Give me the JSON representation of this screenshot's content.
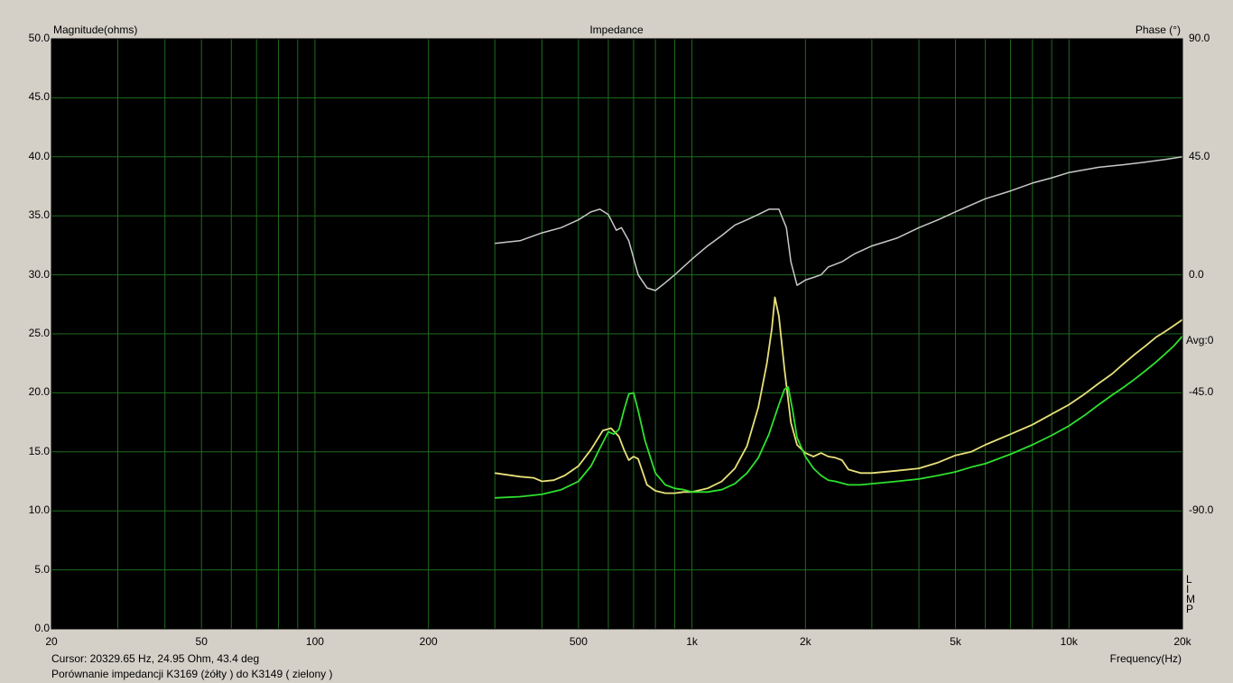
{
  "chart_data": {
    "type": "line",
    "title": "Impedance",
    "ylabel": "Magnitude(ohms)",
    "y2label": "Phase (°)",
    "xlabel": "Frequency(Hz)",
    "xscale": "log",
    "xlim": [
      20,
      20000
    ],
    "ylim": [
      0,
      50
    ],
    "y2lim": [
      -135,
      90
    ],
    "grid": true,
    "x_ticks": [
      {
        "v": 20,
        "label": "20"
      },
      {
        "v": 50,
        "label": "50"
      },
      {
        "v": 100,
        "label": "100"
      },
      {
        "v": 200,
        "label": "200"
      },
      {
        "v": 500,
        "label": "500"
      },
      {
        "v": 1000,
        "label": "1k"
      },
      {
        "v": 2000,
        "label": "2k"
      },
      {
        "v": 5000,
        "label": "5k"
      },
      {
        "v": 10000,
        "label": "10k"
      },
      {
        "v": 20000,
        "label": "20k"
      }
    ],
    "y_ticks": [
      {
        "v": 0,
        "label": "0.0"
      },
      {
        "v": 5,
        "label": "5.0"
      },
      {
        "v": 10,
        "label": "10.0"
      },
      {
        "v": 15,
        "label": "15.0"
      },
      {
        "v": 20,
        "label": "20.0"
      },
      {
        "v": 25,
        "label": "25.0"
      },
      {
        "v": 30,
        "label": "30.0"
      },
      {
        "v": 35,
        "label": "35.0"
      },
      {
        "v": 40,
        "label": "40.0"
      },
      {
        "v": 45,
        "label": "45.0"
      },
      {
        "v": 50,
        "label": "50.0"
      }
    ],
    "y2_ticks": [
      {
        "v": 90,
        "label": "90.0"
      },
      {
        "v": 45,
        "label": "45.0"
      },
      {
        "v": 0,
        "label": "0.0"
      },
      {
        "v": -45,
        "label": "-45.0"
      },
      {
        "v": -90,
        "label": "-90.0"
      }
    ],
    "avg_label": "Avg:0",
    "side_letters": [
      "L",
      "I",
      "M",
      "P"
    ],
    "series": [
      {
        "color": "#e8e07a",
        "axis": "left",
        "x": [
          300,
          350,
          380,
          400,
          430,
          460,
          500,
          540,
          580,
          610,
          640,
          660,
          680,
          700,
          720,
          760,
          800,
          850,
          900,
          950,
          1000,
          1100,
          1200,
          1300,
          1400,
          1500,
          1580,
          1630,
          1660,
          1700,
          1760,
          1830,
          1900,
          2000,
          2100,
          2200,
          2300,
          2400,
          2500,
          2600,
          2800,
          3000,
          3500,
          4000,
          4500,
          5000,
          5500,
          6000,
          7000,
          8000,
          9000,
          10000,
          11000,
          12000,
          13000,
          14000,
          15000,
          16000,
          17000,
          18000,
          19000,
          20000
        ],
        "y": [
          13.2,
          12.9,
          12.8,
          12.5,
          12.6,
          13.0,
          13.8,
          15.2,
          16.8,
          17.0,
          16.3,
          15.2,
          14.3,
          14.6,
          14.4,
          12.2,
          11.7,
          11.5,
          11.5,
          11.6,
          11.6,
          11.9,
          12.5,
          13.6,
          15.5,
          18.8,
          22.5,
          25.5,
          28.1,
          26.5,
          22.0,
          17.5,
          15.6,
          14.9,
          14.6,
          14.9,
          14.6,
          14.5,
          14.3,
          13.5,
          13.2,
          13.2,
          13.4,
          13.6,
          14.1,
          14.7,
          15.0,
          15.6,
          16.5,
          17.3,
          18.2,
          19.0,
          19.9,
          20.8,
          21.6,
          22.5,
          23.3,
          24.0,
          24.7,
          25.2,
          25.7,
          26.2
        ]
      },
      {
        "color": "#2ee02e",
        "axis": "left",
        "x": [
          300,
          350,
          400,
          450,
          500,
          540,
          570,
          600,
          620,
          640,
          660,
          680,
          700,
          720,
          750,
          800,
          850,
          900,
          950,
          1000,
          1100,
          1200,
          1300,
          1400,
          1500,
          1600,
          1700,
          1760,
          1800,
          1850,
          1900,
          2000,
          2100,
          2200,
          2300,
          2400,
          2600,
          2800,
          3000,
          3500,
          4000,
          4500,
          5000,
          5500,
          6000,
          7000,
          8000,
          9000,
          10000,
          11000,
          12000,
          13000,
          14000,
          15000,
          16000,
          17000,
          18000,
          19000,
          20000
        ],
        "y": [
          11.1,
          11.2,
          11.4,
          11.8,
          12.5,
          13.8,
          15.3,
          16.7,
          16.5,
          16.9,
          18.5,
          19.9,
          20.0,
          18.5,
          16.0,
          13.2,
          12.2,
          11.9,
          11.8,
          11.6,
          11.6,
          11.8,
          12.3,
          13.2,
          14.5,
          16.5,
          19.0,
          20.3,
          20.5,
          18.5,
          16.2,
          14.6,
          13.6,
          13.0,
          12.6,
          12.5,
          12.2,
          12.2,
          12.3,
          12.5,
          12.7,
          13.0,
          13.3,
          13.7,
          14.0,
          14.8,
          15.6,
          16.4,
          17.2,
          18.1,
          19.0,
          19.8,
          20.5,
          21.2,
          21.9,
          22.6,
          23.3,
          24.0,
          24.8
        ]
      },
      {
        "color": "#c8c8c8",
        "axis": "right",
        "x": [
          300,
          350,
          400,
          450,
          500,
          540,
          570,
          600,
          630,
          650,
          680,
          720,
          760,
          800,
          850,
          900,
          1000,
          1100,
          1200,
          1300,
          1400,
          1500,
          1600,
          1700,
          1780,
          1830,
          1900,
          1950,
          2000,
          2100,
          2200,
          2300,
          2500,
          2700,
          3000,
          3500,
          4000,
          4500,
          5000,
          6000,
          7000,
          8000,
          9000,
          10000,
          12000,
          14000,
          16000,
          18000,
          20000
        ],
        "y": [
          12,
          13,
          16,
          18,
          21,
          24,
          25,
          23,
          17,
          18,
          13,
          0,
          -5,
          -6,
          -3,
          0,
          6,
          11,
          15,
          19,
          21,
          23,
          25,
          25,
          18,
          5,
          -4,
          -3,
          -2,
          -1,
          0,
          3,
          5,
          8,
          11,
          14,
          18,
          21,
          24,
          29,
          32,
          35,
          37,
          39,
          41,
          42,
          43,
          44,
          45
        ]
      }
    ]
  },
  "status": {
    "cursor": "Cursor: 20329.65 Hz, 24.95 Ohm, 43.4 deg",
    "caption": "Porównanie impedancji K3169 (żółty ) do K3149 ( zielony )"
  }
}
